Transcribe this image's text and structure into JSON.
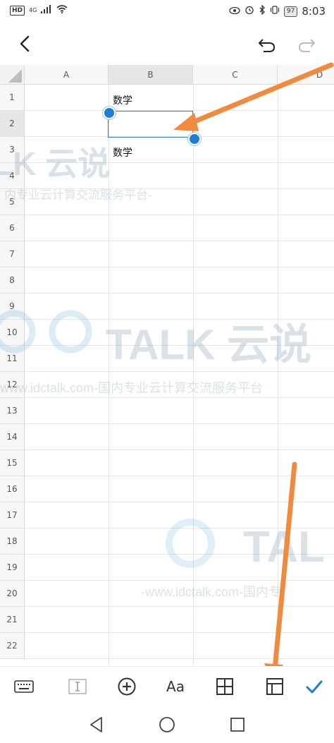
{
  "status_bar": {
    "hd_label": "HD",
    "network": "4G",
    "battery": "97",
    "time": "8:03"
  },
  "toolbar": {
    "back_icon": "chevron-left-icon",
    "undo_icon": "undo-icon",
    "redo_icon": "redo-icon"
  },
  "sheet": {
    "columns": [
      "A",
      "B",
      "C",
      "D"
    ],
    "rows": [
      "1",
      "2",
      "3",
      "4",
      "5",
      "6",
      "7",
      "8",
      "9",
      "10",
      "11",
      "12",
      "13",
      "14",
      "15",
      "16",
      "17",
      "18",
      "19",
      "20",
      "21",
      "22"
    ],
    "cells": {
      "B1": "数学",
      "B3": "数学"
    },
    "selected_cell": "B2"
  },
  "watermark": {
    "brand_top": "LK 云说",
    "sub_top": "内专业云计算交流服务平台-",
    "brand_mid": "TALK 云说",
    "sub_mid": "www.idctalk.com-国内专业云计算交流服务平台",
    "brand_low": "TAL",
    "sub_low": "-www.idctalk.com-国内专"
  },
  "bottom_toolbar": {
    "keyboard_icon": "keyboard-icon",
    "text_cursor_icon": "text-cursor-icon",
    "insert_icon": "plus-circle-icon",
    "font_label": "Aa",
    "border_icon": "grid-border-icon",
    "freeze_icon": "freeze-panes-icon",
    "confirm_icon": "checkmark-icon"
  },
  "nav_bar": {
    "back_icon": "triangle-back-icon",
    "home_icon": "circle-home-icon",
    "recents_icon": "square-recents-icon"
  },
  "colors": {
    "accent": "#1e7ed6",
    "annotation_arrow": "#f08a3c",
    "grid_line": "#e3e3e3",
    "header_bg": "#f7f7f7"
  }
}
